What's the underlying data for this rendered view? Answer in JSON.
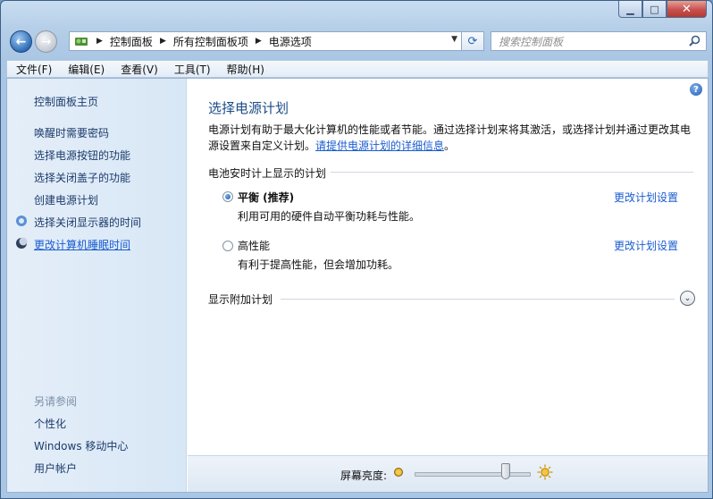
{
  "address_bar": {
    "crumbs": [
      "控制面板",
      "所有控制面板项",
      "电源选项"
    ]
  },
  "search": {
    "placeholder": "搜索控制面板"
  },
  "menu": [
    "文件(F)",
    "编辑(E)",
    "查看(V)",
    "工具(T)",
    "帮助(H)"
  ],
  "sidebar": {
    "home": "控制面板主页",
    "links": [
      "唤醒时需要密码",
      "选择电源按钮的功能",
      "选择关闭盖子的功能",
      "创建电源计划",
      "选择关闭显示器的时间",
      "更改计算机睡眠时间"
    ],
    "see_also_title": "另请参阅",
    "see_also": [
      "个性化",
      "Windows 移动中心",
      "用户帐户"
    ]
  },
  "main": {
    "title": "选择电源计划",
    "description": "电源计划有助于最大化计算机的性能或者节能。通过选择计划来将其激活，或选择计划并通过更改其电源设置来自定义计划。",
    "description_link": "请提供电源计划的详细信息",
    "description_end": "。",
    "group_header": "电池安时计上显示的计划",
    "plans": [
      {
        "name": "平衡 (推荐)",
        "desc": "利用可用的硬件自动平衡功耗与性能。",
        "link": "更改计划设置",
        "selected": true
      },
      {
        "name": "高性能",
        "desc": "有利于提高性能，但会增加功耗。",
        "link": "更改计划设置",
        "selected": false
      }
    ],
    "more_plans": "显示附加计划"
  },
  "brightness": {
    "label": "屏幕亮度:",
    "level": 0.8
  },
  "icons": [
    "back-arrow-icon",
    "forward-arrow-icon",
    "control-panel-icon",
    "refresh-icon",
    "search-icon",
    "help-icon",
    "shield-icon",
    "moon-icon",
    "chevron-down-icon",
    "sun-icon"
  ]
}
